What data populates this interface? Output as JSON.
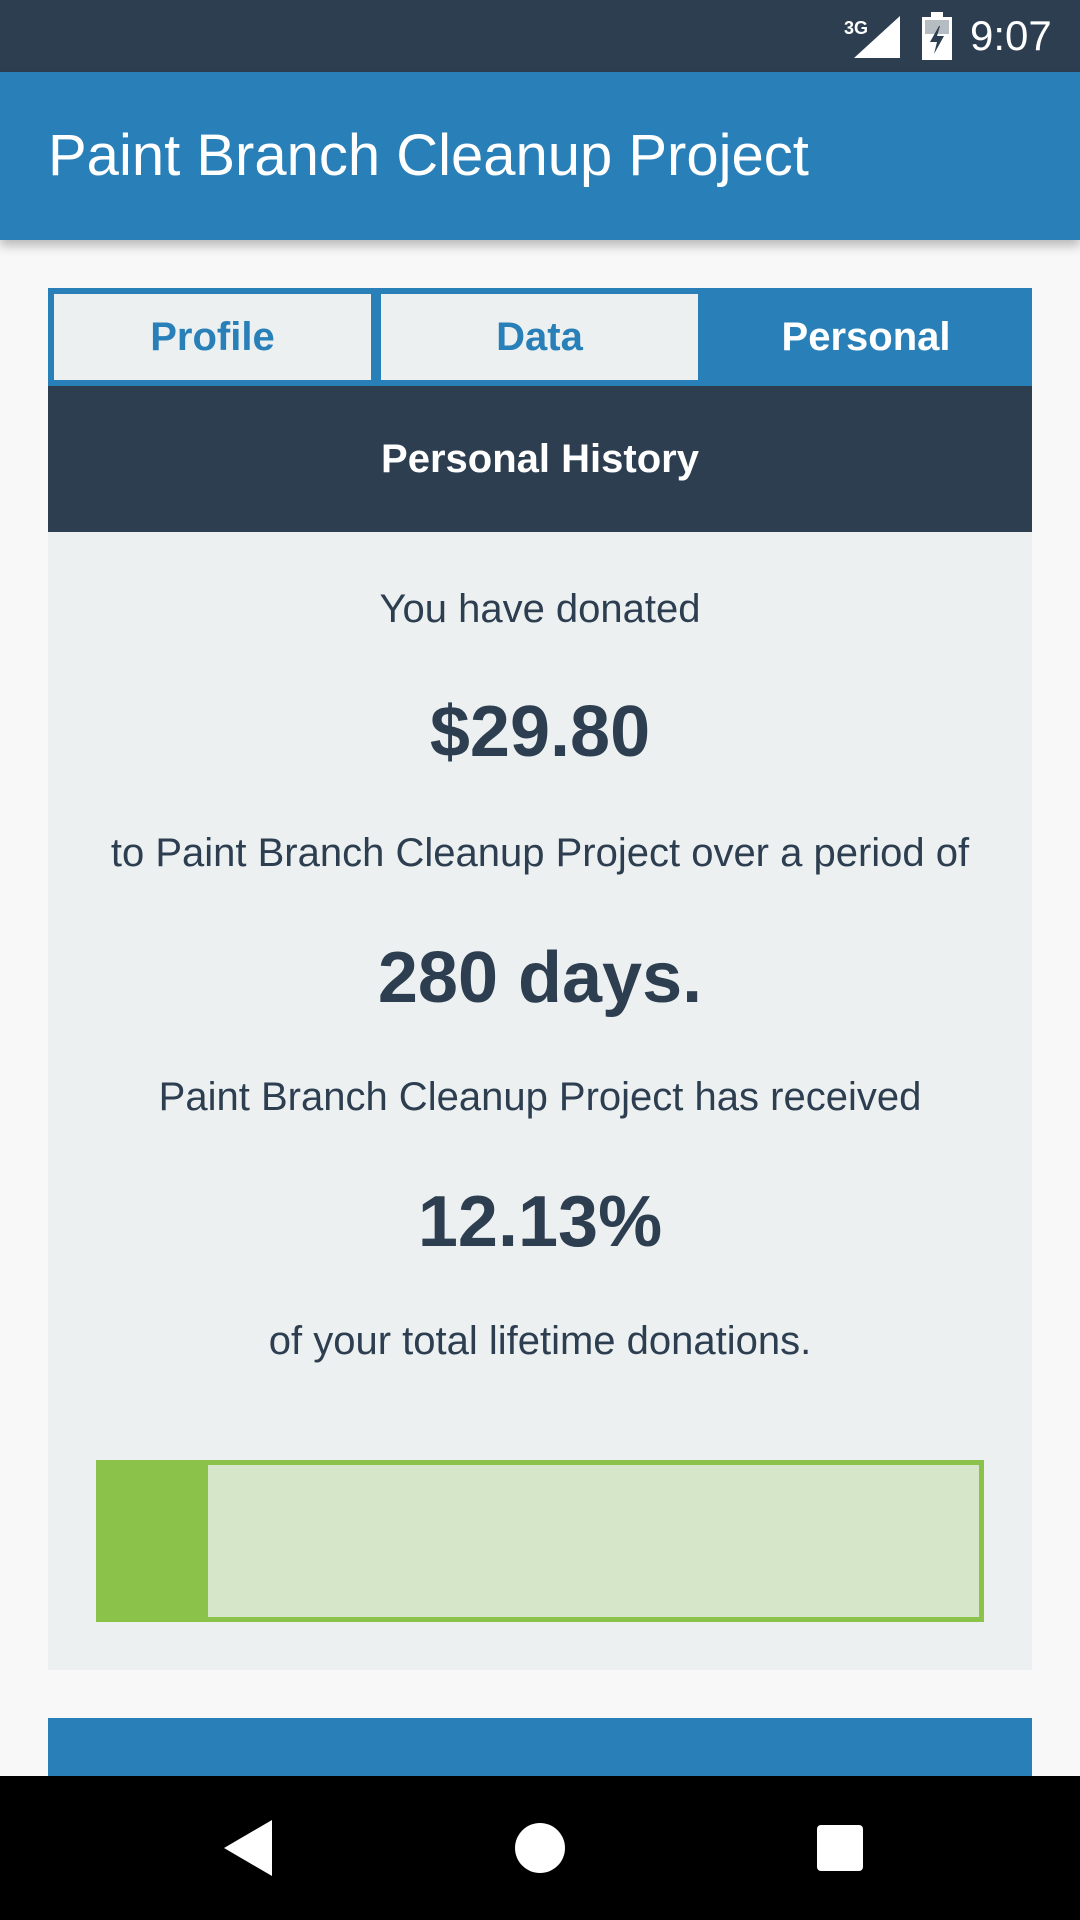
{
  "status_bar": {
    "network": "3G",
    "time": "9:07"
  },
  "app_bar": {
    "title": "Paint Branch Cleanup Project"
  },
  "tabs": [
    {
      "label": "Profile",
      "active": false
    },
    {
      "label": "Data",
      "active": false
    },
    {
      "label": "Personal",
      "active": true
    }
  ],
  "section": {
    "header": "Personal History",
    "donated_intro": "You have donated",
    "amount": "$29.80",
    "period_intro": "to Paint Branch Cleanup Project over a period of",
    "days": "280 days.",
    "received_intro": "Paint Branch Cleanup Project has received",
    "percent": "12.13%",
    "percent_outro": "of your total lifetime donations.",
    "progress_fraction": 0.1213
  },
  "colors": {
    "primary": "#2980b9",
    "dark": "#2c3e50",
    "card_bg": "#ecf0f1",
    "progress_fill": "#8bc34a",
    "progress_track": "#d6e7c9"
  },
  "nav_bar": {
    "icons": [
      "back-icon",
      "home-icon",
      "recents-icon"
    ]
  }
}
